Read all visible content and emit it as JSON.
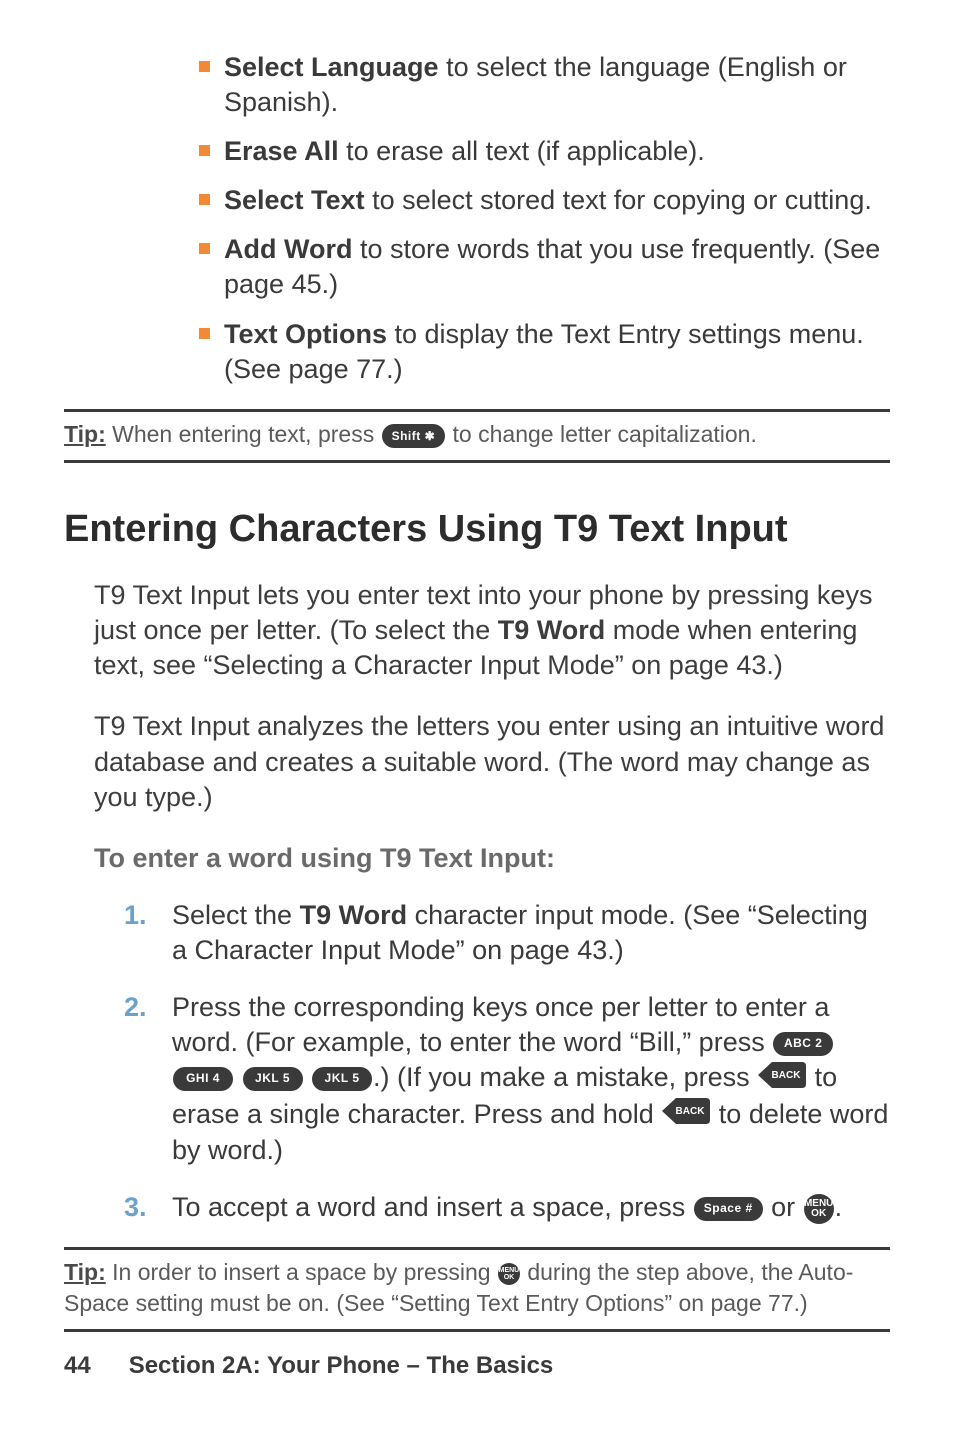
{
  "bullets": [
    {
      "label": "Select Language",
      "rest": " to select the language (English or Spanish)."
    },
    {
      "label": "Erase All",
      "rest": " to erase all text (if applicable)."
    },
    {
      "label": "Select Text",
      "rest": " to select stored text for copying or cutting."
    },
    {
      "label": "Add Word",
      "rest": " to store words that you use frequently. (See page 45.)"
    },
    {
      "label": "Text Options",
      "rest": " to display the Text Entry settings menu. (See page 77.)"
    }
  ],
  "tip1": {
    "label": "Tip:",
    "before": " When entering text, press ",
    "key": "Shift ✱",
    "after": " to change letter capitalization."
  },
  "heading": "Entering Characters Using T9 Text Input",
  "para1a": "T9 Text Input lets you enter text into your phone by pressing keys just once per letter. (To select the ",
  "para1b": "T9 Word",
  "para1c": " mode when entering text, see “Selecting a Character Input Mode” on page 43.)",
  "para2": "T9 Text Input analyzes the letters you enter using an intuitive word database and creates a suitable word. (The word may change as you type.)",
  "subhead": "To enter a word using T9 Text Input:",
  "steps": {
    "s1": {
      "num": "1.",
      "a": "Select the ",
      "b": "T9 Word",
      "c": " character input mode. (See “Selecting a Character Input Mode” on page 43.)"
    },
    "s2": {
      "num": "2.",
      "a": "Press the corresponding keys once per letter to enter a word. (For example, to enter the word “Bill,” press ",
      "keys": {
        "k1": "ABC 2",
        "k2": "GHI 4",
        "k3": "JKL 5",
        "k4": "JKL 5"
      },
      "b": ".) (If you make a mistake, press ",
      "c": " to erase a single character. Press and hold ",
      "d": " to delete word by word.)"
    },
    "s3": {
      "num": "3.",
      "a": "To accept a word and insert a space, press ",
      "space_key": "Space #",
      "b": " or ",
      "menu": "MENU\nOK",
      "c": "."
    }
  },
  "tip2": {
    "label": "Tip:",
    "a": " In order to insert a space by pressing ",
    "menu": "MENU\nOK",
    "b": " during the step above, the Auto-Space setting must be on. (See “Setting Text Entry Options” on page 77.)"
  },
  "footer": {
    "page": "44",
    "section": "Section 2A: Your Phone – The Basics"
  },
  "chart_data": {
    "type": "table",
    "note": "no chart present"
  }
}
